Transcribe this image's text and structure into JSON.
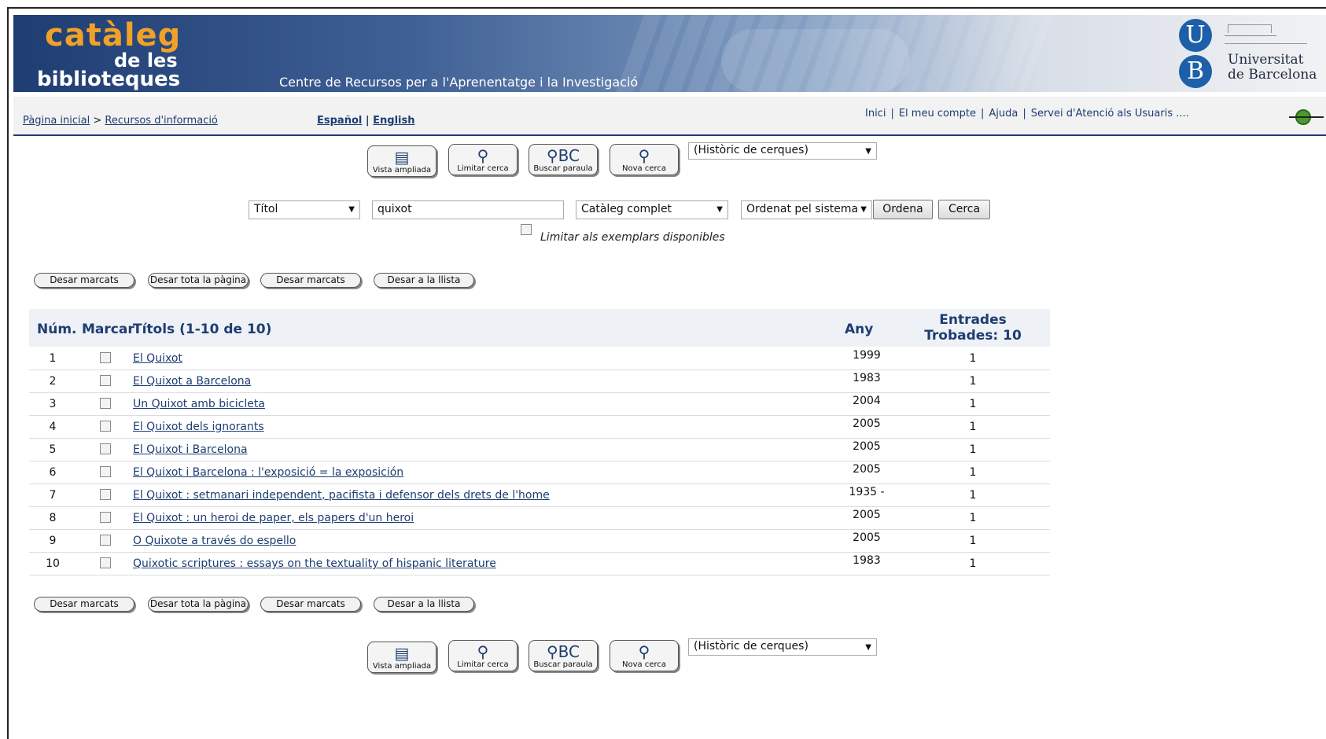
{
  "banner": {
    "logo_line1": "catàleg",
    "logo_line2": "de les",
    "logo_line3": "biblioteques",
    "subtitle": "Centre de Recursos per a l'Aprenentatge i la Investigació",
    "ub_letter_u": "U",
    "ub_letter_b": "B",
    "ub_name_line1": "Universitat",
    "ub_name_line2": "de Barcelona"
  },
  "nav": {
    "crumb_home": "Pàgina inicial",
    "crumb_sep": " > ",
    "crumb_resources": "Recursos d'informació",
    "lang_es": "Español",
    "lang_sep": " | ",
    "lang_en": "English",
    "links": [
      "Inici",
      "El meu compte",
      "Ajuda",
      "Servei d'Atenció als Usuaris"
    ],
    "link_sep": "|",
    "trailing": "...."
  },
  "toolbar": {
    "buttons": [
      "Vista ampliada",
      "Limitar cerca",
      "Buscar paraula",
      "Nova cerca"
    ],
    "history_select": "(Històric de cerques)"
  },
  "search": {
    "field_select": "Títol",
    "query": "quixot",
    "catalog_select": "Catàleg complet",
    "sort_select": "Ordenat pel sistema",
    "sort_button": "Ordena",
    "search_button": "Cerca",
    "limit_label": "Limitar als exemplars disponibles"
  },
  "actions": {
    "buttons": [
      "Desar marcats",
      "Desar tota la pàgina",
      "Desar marcats",
      "Desar a la llista"
    ]
  },
  "table": {
    "col_num": "Núm.",
    "col_mark": "Marcar",
    "col_titles": "Títols (1-10 de 10)",
    "col_year": "Any",
    "col_entries_line1": "Entrades",
    "col_entries_line2": "Trobades: 10",
    "rows": [
      {
        "num": "1",
        "title": "El Quixot",
        "year": "1999",
        "entries": "1"
      },
      {
        "num": "2",
        "title": "El Quixot a Barcelona",
        "year": "1983",
        "entries": "1"
      },
      {
        "num": "3",
        "title": "Un Quixot amb bicicleta",
        "year": "2004",
        "entries": "1"
      },
      {
        "num": "4",
        "title": "El Quixot dels ignorants",
        "year": "2005",
        "entries": "1"
      },
      {
        "num": "5",
        "title": "El Quixot i Barcelona",
        "year": "2005",
        "entries": "1"
      },
      {
        "num": "6",
        "title": "El Quixot i Barcelona : l'exposició = la exposición",
        "year": "2005",
        "entries": "1"
      },
      {
        "num": "7",
        "title": "El Quixot : setmanari independent, pacifista i defensor dels drets de l'home",
        "year": "1935 -",
        "entries": "1"
      },
      {
        "num": "8",
        "title": "El Quixot : un heroi de paper, els papers d'un heroi",
        "year": "2005",
        "entries": "1"
      },
      {
        "num": "9",
        "title": "O Quixote a través do espello",
        "year": "2005",
        "entries": "1"
      },
      {
        "num": "10",
        "title": "Quixotic scriptures : essays on the textuality of hispanic literature",
        "year": "1983",
        "entries": "1"
      }
    ]
  },
  "colors": {
    "navy": "#1e3d72",
    "orange": "#f2a128",
    "ub_blue": "#1d5fa8"
  }
}
